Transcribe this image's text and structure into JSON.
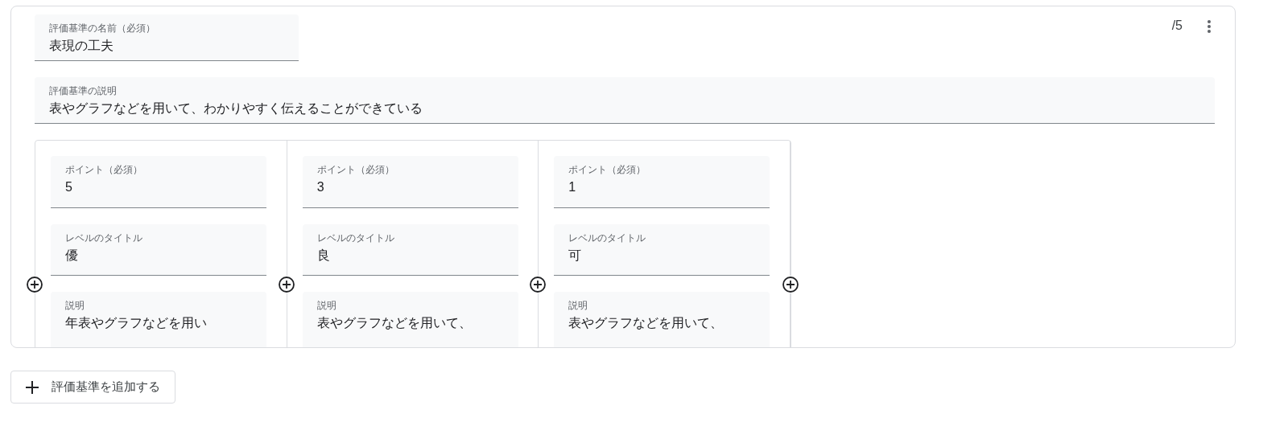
{
  "criterion": {
    "name_field": {
      "label": "評価基準の名前（必須）",
      "value": "表現の工夫"
    },
    "score": "/5",
    "description_field": {
      "label": "評価基準の説明",
      "value": "表やグラフなどを用いて、わかりやすく伝えることができている"
    },
    "levels": [
      {
        "point_label": "ポイント（必須）",
        "point": "5",
        "title_label": "レベルのタイトル",
        "title": "優",
        "description_label": "説明",
        "description": "年表やグラフなどを用い"
      },
      {
        "point_label": "ポイント（必須）",
        "point": "3",
        "title_label": "レベルのタイトル",
        "title": "良",
        "description_label": "説明",
        "description": "表やグラフなどを用いて、"
      },
      {
        "point_label": "ポイント（必須）",
        "point": "1",
        "title_label": "レベルのタイトル",
        "title": "可",
        "description_label": "説明",
        "description": "表やグラフなどを用いて、"
      }
    ]
  },
  "add_button": {
    "label": "評価基準を追加する"
  }
}
